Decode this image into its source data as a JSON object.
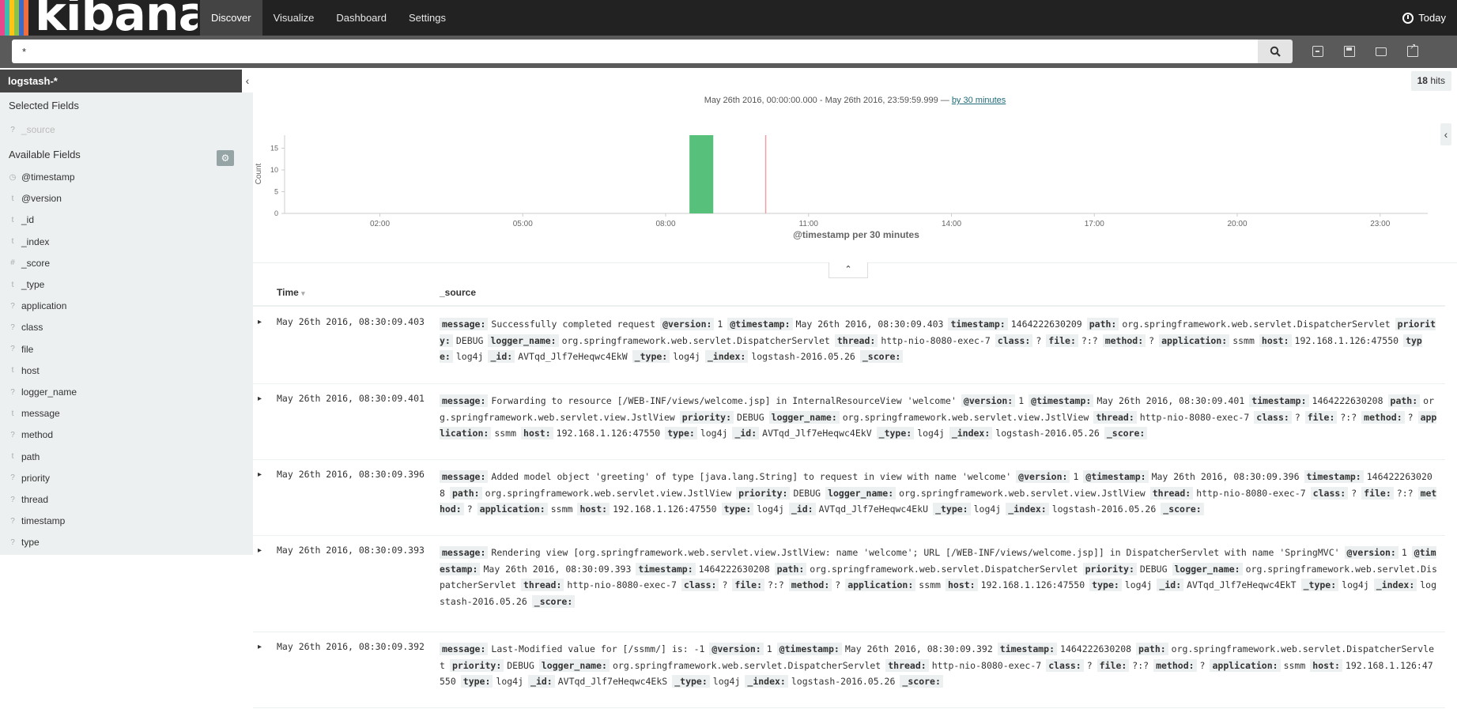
{
  "app": {
    "brand": "kibana",
    "stripe_colors": [
      "#e8488b",
      "#3cbeb1",
      "#fec514",
      "#8bc34a",
      "#3f6bc4",
      "#f06d3c"
    ]
  },
  "nav": {
    "items": [
      "Discover",
      "Visualize",
      "Dashboard",
      "Settings"
    ],
    "active": 0,
    "time_label": "Today"
  },
  "search": {
    "query": "*"
  },
  "sidebar": {
    "index_pattern": "logstash-*",
    "selected_title": "Selected Fields",
    "selected_fields": [
      {
        "type": "?",
        "name": "_source"
      }
    ],
    "available_title": "Available Fields",
    "fields": [
      {
        "type": "◷",
        "name": "@timestamp"
      },
      {
        "type": "t",
        "name": "@version"
      },
      {
        "type": "t",
        "name": "_id"
      },
      {
        "type": "t",
        "name": "_index"
      },
      {
        "type": "#",
        "name": "_score"
      },
      {
        "type": "t",
        "name": "_type"
      },
      {
        "type": "?",
        "name": "application"
      },
      {
        "type": "?",
        "name": "class"
      },
      {
        "type": "?",
        "name": "file"
      },
      {
        "type": "t",
        "name": "host"
      },
      {
        "type": "?",
        "name": "logger_name"
      },
      {
        "type": "t",
        "name": "message"
      },
      {
        "type": "?",
        "name": "method"
      },
      {
        "type": "t",
        "name": "path"
      },
      {
        "type": "?",
        "name": "priority"
      },
      {
        "type": "?",
        "name": "thread"
      },
      {
        "type": "?",
        "name": "timestamp"
      },
      {
        "type": "?",
        "name": "type"
      }
    ]
  },
  "results": {
    "hits_count": "18",
    "hits_label": "hits",
    "range_text": "May 26th 2016, 00:00:00.000 - May 26th 2016, 23:59:59.999 —",
    "interval_link": "by 30 minutes"
  },
  "chart_data": {
    "type": "bar",
    "x_start_hour": 0,
    "x_end_hour": 24,
    "x_ticks": [
      "02:00",
      "05:00",
      "08:00",
      "11:00",
      "14:00",
      "17:00",
      "20:00",
      "23:00"
    ],
    "bars": [
      {
        "start_hour": 8.5,
        "end_hour": 9.0,
        "value": 18
      }
    ],
    "now_marker_hour": 10.1,
    "y_ticks": [
      0,
      5,
      10,
      15
    ],
    "ylim": [
      0,
      18
    ],
    "ylabel": "Count",
    "xlabel": "@timestamp per 30 minutes",
    "bar_color": "#57c17b",
    "marker_color": "#e7a0a5"
  },
  "table": {
    "col_time": "Time",
    "col_source": "_source",
    "rows": [
      {
        "time": "May 26th 2016, 08:30:09.403",
        "fields": [
          [
            "message:",
            "Successfully completed request"
          ],
          [
            "@version:",
            "1"
          ],
          [
            "@timestamp:",
            "May 26th 2016, 08:30:09.403"
          ],
          [
            "timestamp:",
            "1464222630209"
          ],
          [
            "path:",
            "org.springframework.web.servlet.DispatcherServlet"
          ],
          [
            "priority:",
            "DEBUG"
          ],
          [
            "logger_name:",
            "org.springframework.web.servlet.DispatcherServlet"
          ],
          [
            "thread:",
            "http-nio-8080-exec-7"
          ],
          [
            "class:",
            "?"
          ],
          [
            "file:",
            "?:?"
          ],
          [
            "method:",
            "?"
          ],
          [
            "application:",
            "ssmm"
          ],
          [
            "host:",
            "192.168.1.126:47550"
          ],
          [
            "type:",
            "log4j"
          ],
          [
            "_id:",
            "AVTqd_Jlf7eHeqwc4EkW"
          ],
          [
            "_type:",
            "log4j"
          ],
          [
            "_index:",
            "logstash-2016.05.26"
          ],
          [
            "_score:",
            ""
          ]
        ]
      },
      {
        "time": "May 26th 2016, 08:30:09.401",
        "fields": [
          [
            "message:",
            "Forwarding to resource [/WEB-INF/views/welcome.jsp] in InternalResourceView 'welcome'"
          ],
          [
            "@version:",
            "1"
          ],
          [
            "@timestamp:",
            "May 26th 2016, 08:30:09.401"
          ],
          [
            "timestamp:",
            "1464222630208"
          ],
          [
            "path:",
            "org.springframework.web.servlet.view.JstlView"
          ],
          [
            "priority:",
            "DEBUG"
          ],
          [
            "logger_name:",
            "org.springframework.web.servlet.view.JstlView"
          ],
          [
            "thread:",
            "http-nio-8080-exec-7"
          ],
          [
            "class:",
            "?"
          ],
          [
            "file:",
            "?:?"
          ],
          [
            "method:",
            "?"
          ],
          [
            "application:",
            "ssmm"
          ],
          [
            "host:",
            "192.168.1.126:47550"
          ],
          [
            "type:",
            "log4j"
          ],
          [
            "_id:",
            "AVTqd_Jlf7eHeqwc4EkV"
          ],
          [
            "_type:",
            "log4j"
          ],
          [
            "_index:",
            "logstash-2016.05.26"
          ],
          [
            "_score:",
            ""
          ]
        ]
      },
      {
        "time": "May 26th 2016, 08:30:09.396",
        "fields": [
          [
            "message:",
            "Added model object 'greeting' of type [java.lang.String] to request in view with name 'welcome'"
          ],
          [
            "@version:",
            "1"
          ],
          [
            "@timestamp:",
            "May 26th 2016, 08:30:09.396"
          ],
          [
            "timestamp:",
            "1464222630208"
          ],
          [
            "path:",
            "org.springframework.web.servlet.view.JstlView"
          ],
          [
            "priority:",
            "DEBUG"
          ],
          [
            "logger_name:",
            "org.springframework.web.servlet.view.JstlView"
          ],
          [
            "thread:",
            "http-nio-8080-exec-7"
          ],
          [
            "class:",
            "?"
          ],
          [
            "file:",
            "?:?"
          ],
          [
            "method:",
            "?"
          ],
          [
            "application:",
            "ssmm"
          ],
          [
            "host:",
            "192.168.1.126:47550"
          ],
          [
            "type:",
            "log4j"
          ],
          [
            "_id:",
            "AVTqd_Jlf7eHeqwc4EkU"
          ],
          [
            "_type:",
            "log4j"
          ],
          [
            "_index:",
            "logstash-2016.05.26"
          ],
          [
            "_score:",
            ""
          ]
        ]
      },
      {
        "time": "May 26th 2016, 08:30:09.393",
        "fields": [
          [
            "message:",
            "Rendering view [org.springframework.web.servlet.view.JstlView: name 'welcome'; URL [/WEB-INF/views/welcome.jsp]] in DispatcherServlet with name 'SpringMVC'"
          ],
          [
            "@version:",
            "1"
          ],
          [
            "@timestamp:",
            "May 26th 2016, 08:30:09.393"
          ],
          [
            "timestamp:",
            "1464222630208"
          ],
          [
            "path:",
            "org.springframework.web.servlet.DispatcherServlet"
          ],
          [
            "priority:",
            "DEBUG"
          ],
          [
            "logger_name:",
            "org.springframework.web.servlet.DispatcherServlet"
          ],
          [
            "thread:",
            "http-nio-8080-exec-7"
          ],
          [
            "class:",
            "?"
          ],
          [
            "file:",
            "?:?"
          ],
          [
            "method:",
            "?"
          ],
          [
            "application:",
            "ssmm"
          ],
          [
            "host:",
            "192.168.1.126:47550"
          ],
          [
            "type:",
            "log4j"
          ],
          [
            "_id:",
            "AVTqd_Jlf7eHeqwc4EkT"
          ],
          [
            "_type:",
            "log4j"
          ],
          [
            "_index:",
            "logstash-2016.05.26"
          ],
          [
            "_score:",
            ""
          ]
        ]
      },
      {
        "time": "May 26th 2016, 08:30:09.392",
        "fields": [
          [
            "message:",
            "Last-Modified value for [/ssmm/] is: -1"
          ],
          [
            "@version:",
            "1"
          ],
          [
            "@timestamp:",
            "May 26th 2016, 08:30:09.392"
          ],
          [
            "timestamp:",
            "1464222630208"
          ],
          [
            "path:",
            "org.springframework.web.servlet.DispatcherServlet"
          ],
          [
            "priority:",
            "DEBUG"
          ],
          [
            "logger_name:",
            "org.springframework.web.servlet.DispatcherServlet"
          ],
          [
            "thread:",
            "http-nio-8080-exec-7"
          ],
          [
            "class:",
            "?"
          ],
          [
            "file:",
            "?:?"
          ],
          [
            "method:",
            "?"
          ],
          [
            "application:",
            "ssmm"
          ],
          [
            "host:",
            "192.168.1.126:47550"
          ],
          [
            "type:",
            "log4j"
          ],
          [
            "_id:",
            "AVTqd_Jlf7eHeqwc4EkS"
          ],
          [
            "_type:",
            "log4j"
          ],
          [
            "_index:",
            "logstash-2016.05.26"
          ],
          [
            "_score:",
            ""
          ]
        ]
      }
    ]
  }
}
